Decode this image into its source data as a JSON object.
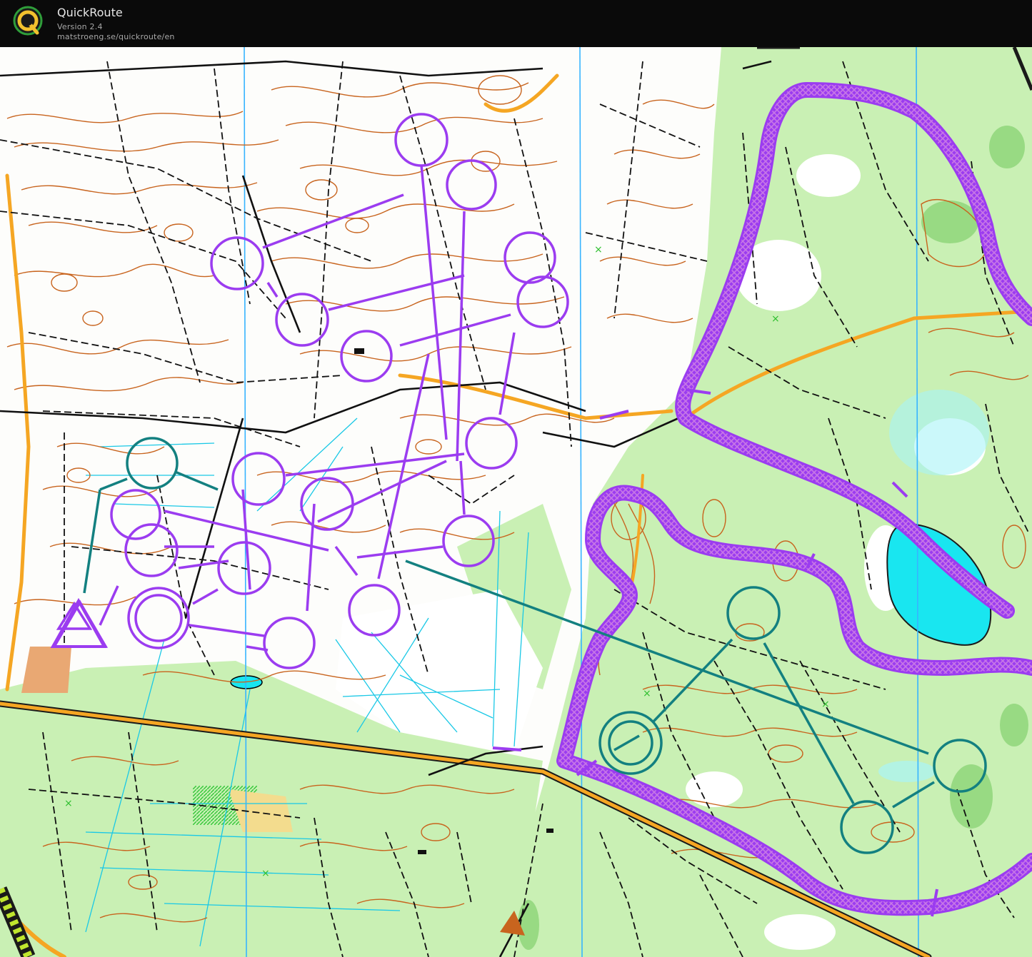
{
  "app": {
    "title": "QuickRoute",
    "version": "Version 2.4",
    "url": "matstroeng.se/quickroute/en"
  },
  "colors": {
    "background": "#000000",
    "map_paper": "#ffffff",
    "forest_green": "#c9f0b4",
    "dark_green": "#8fd67a",
    "contour_brown": "#c8641e",
    "road_orange": "#f5a623",
    "water_blue": "#19e6f0",
    "north_line_blue": "#37b4ff",
    "course_purple": "#9b3cf0",
    "course_teal": "#138080",
    "track_purple": "#b464dc"
  },
  "icons": [
    "quickroute-logo-icon",
    "start-triangle-icon",
    "control-circle-icon"
  ]
}
